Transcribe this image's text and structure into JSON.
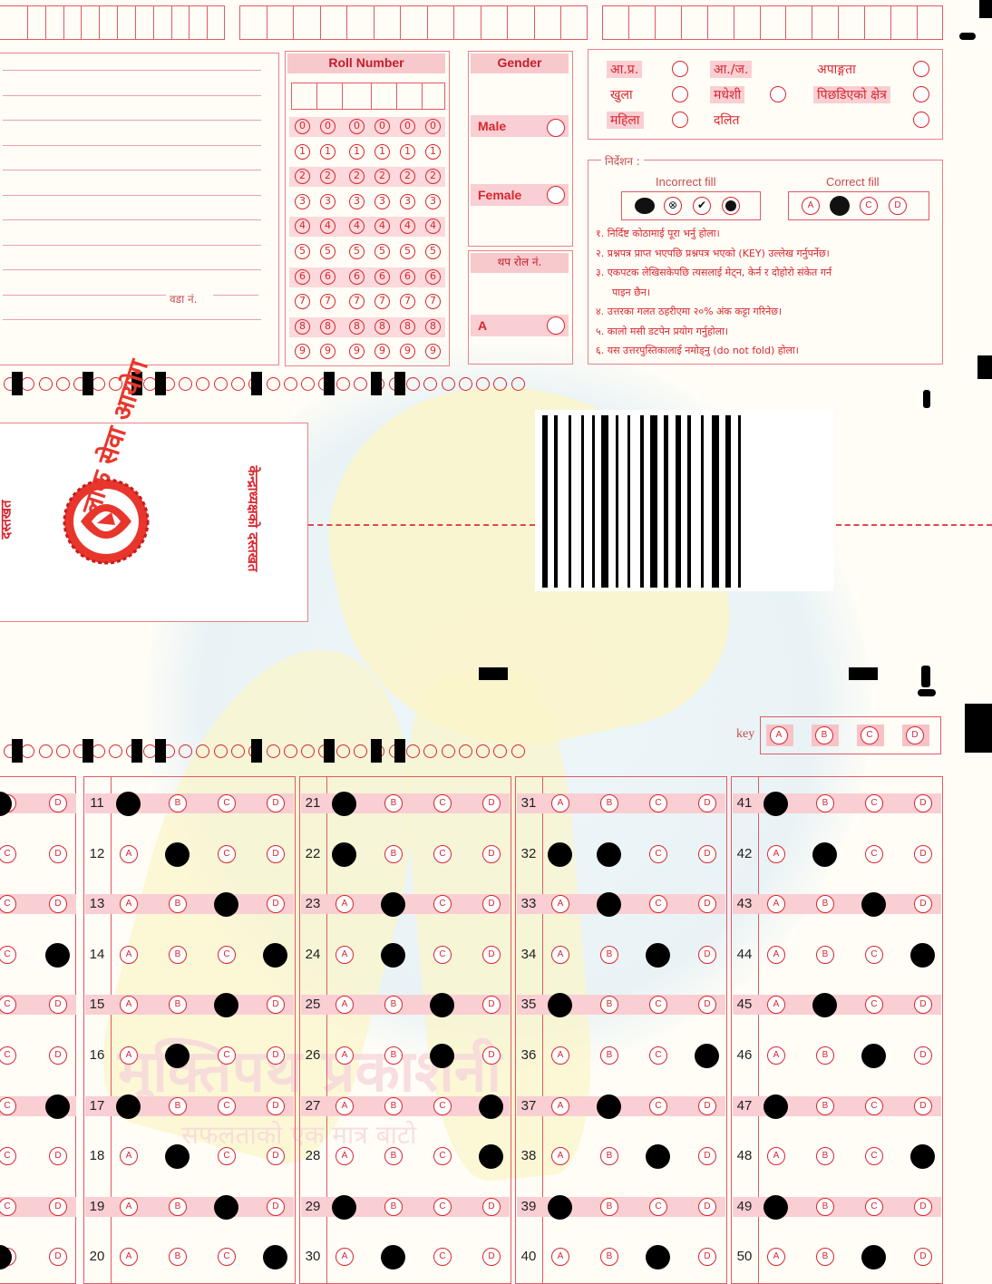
{
  "roll_section": {
    "title": "Roll Number",
    "digits": [
      "0",
      "1",
      "2",
      "3",
      "4",
      "5",
      "6",
      "7",
      "8",
      "9"
    ],
    "ward_label": "वडा नं."
  },
  "gender_section": {
    "title": "Gender",
    "options": [
      "Male",
      "Female"
    ],
    "extra_roll_label": "थप रोल नं.",
    "extra_option": "A"
  },
  "category_section": {
    "items": [
      {
        "label": "आ.प्र."
      },
      {
        "label": "आ./ज."
      },
      {
        "label": "अपाङ्गता"
      },
      {
        "label": "खुला"
      },
      {
        "label": "मधेशी"
      },
      {
        "label": "पिछडिएको क्षेत्र"
      },
      {
        "label": "महिला"
      },
      {
        "label": "दलित"
      }
    ]
  },
  "instructions": {
    "title": "निर्देशन :",
    "incorrect_label": "Incorrect fill",
    "correct_label": "Correct fill",
    "correct_options": [
      "A",
      "",
      "C",
      "D"
    ],
    "incorrect_marks": [
      "●",
      "⊗",
      "✔",
      "●"
    ],
    "lines": [
      "१. निर्दिष्ट कोठामाई पूरा भर्नु होला।",
      "२. प्रश्नपत्र प्राप्त भएपछि प्रश्नपत्र भएको (KEY) उल्लेख गर्नुपर्नेछ।",
      "३. एकपटक लेखिसकेपछि त्यसलाई मेट्न, केर्न र दोहोरो संकेत गर्न",
      "पाइन छैन।",
      "४. उत्तरका गलत ठहरीएमा २०% अंक कट्टा गरिनेछ।",
      "५. कालो मसी डटपेन प्रयोग गर्नुहोला।",
      "६. यस उत्तरपुस्तिकालाई नमोड्नु (do not fold) होला।"
    ]
  },
  "seal_section": {
    "seal_text": "लोक सेवा आयोग",
    "left_sign_label": "दस्तखत",
    "right_sign_label": "केन्द्राध्यक्षको दस्तखत"
  },
  "key_section": {
    "label": "key",
    "options": [
      "A",
      "B",
      "C",
      "D"
    ]
  },
  "watermark": {
    "line1": "मुक्तिपथ प्रकाशनी",
    "line2": "सफलताको एक मात्र बाटो"
  },
  "answers": {
    "option_letters": [
      "A",
      "B",
      "C",
      "D"
    ],
    "col0": [
      {
        "q": "",
        "filled": 0,
        "visible": [
          0,
          3
        ]
      },
      {
        "q": "",
        "filled": -1,
        "visible": [
          2,
          3
        ]
      },
      {
        "q": "",
        "filled": -1,
        "visible": [
          2,
          3
        ]
      },
      {
        "q": "",
        "filled": 3,
        "visible": [
          2,
          3
        ]
      },
      {
        "q": "",
        "filled": -1,
        "visible": [
          2,
          3
        ]
      },
      {
        "q": "",
        "filled": -1,
        "visible": [
          2,
          3
        ]
      },
      {
        "q": "",
        "filled": 3,
        "visible": [
          2,
          3
        ]
      },
      {
        "q": "",
        "filled": -1,
        "visible": [
          2,
          3
        ]
      },
      {
        "q": "",
        "filled": -1,
        "visible": [
          2,
          3
        ]
      },
      {
        "q": "",
        "filled": 2,
        "visible": [
          2,
          3
        ]
      }
    ],
    "columns": [
      [
        {
          "q": "11",
          "filled": 0
        },
        {
          "q": "12",
          "filled": 1
        },
        {
          "q": "13",
          "filled": 2
        },
        {
          "q": "14",
          "filled": 3
        },
        {
          "q": "15",
          "filled": 2
        },
        {
          "q": "16",
          "filled": 1
        },
        {
          "q": "17",
          "filled": 0
        },
        {
          "q": "18",
          "filled": 1
        },
        {
          "q": "19",
          "filled": 2
        },
        {
          "q": "20",
          "filled": 3
        }
      ],
      [
        {
          "q": "21",
          "filled": 0
        },
        {
          "q": "22",
          "filled": 0
        },
        {
          "q": "23",
          "filled": 1
        },
        {
          "q": "24",
          "filled": 1
        },
        {
          "q": "25",
          "filled": 2
        },
        {
          "q": "26",
          "filled": 2
        },
        {
          "q": "27",
          "filled": 3
        },
        {
          "q": "28",
          "filled": 3
        },
        {
          "q": "29",
          "filled": 0
        },
        {
          "q": "30",
          "filled": 1
        }
      ],
      [
        {
          "q": "31",
          "filled": -1
        },
        {
          "q": "32",
          "filled": 0,
          "filled2": 1
        },
        {
          "q": "33",
          "filled": 1
        },
        {
          "q": "34",
          "filled": 2
        },
        {
          "q": "35",
          "filled": 0
        },
        {
          "q": "36",
          "filled": 3
        },
        {
          "q": "37",
          "filled": 1
        },
        {
          "q": "38",
          "filled": 2
        },
        {
          "q": "39",
          "filled": 0
        },
        {
          "q": "40",
          "filled": 2
        }
      ],
      [
        {
          "q": "41",
          "filled": 0
        },
        {
          "q": "42",
          "filled": 1
        },
        {
          "q": "43",
          "filled": 2
        },
        {
          "q": "44",
          "filled": 3
        },
        {
          "q": "45",
          "filled": 1
        },
        {
          "q": "46",
          "filled": 2
        },
        {
          "q": "47",
          "filled": 0
        },
        {
          "q": "48",
          "filled": 3
        },
        {
          "q": "49",
          "filled": 0
        },
        {
          "q": "50",
          "filled": 2
        }
      ]
    ]
  },
  "colors": {
    "red": "#d9262f",
    "pink": "#f9cfd3",
    "fill": "#000000"
  }
}
